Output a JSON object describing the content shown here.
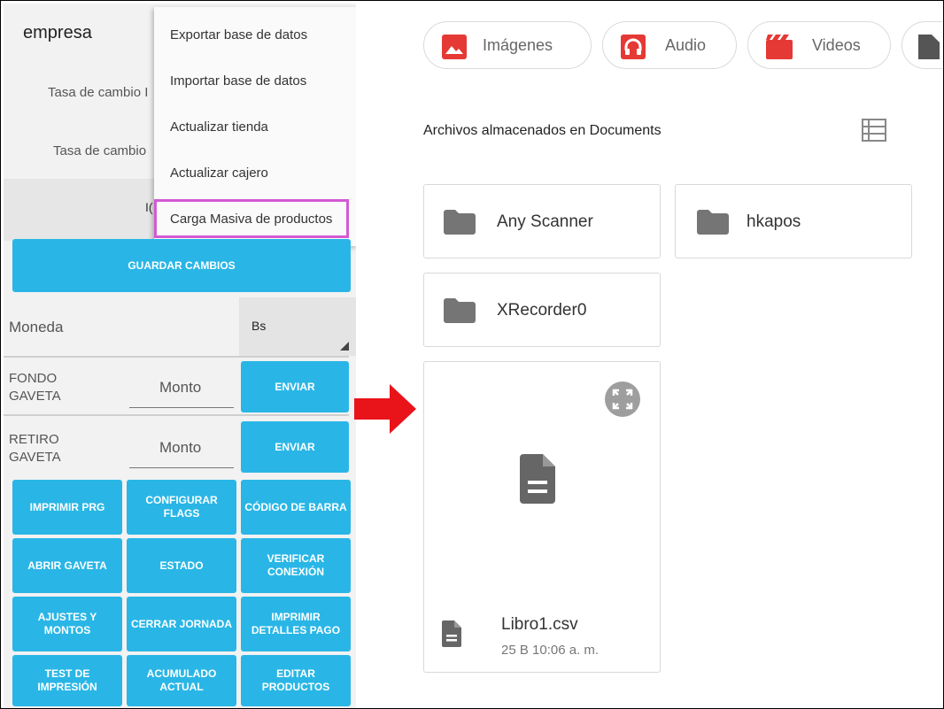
{
  "app": {
    "title": "empresa"
  },
  "rates": [
    {
      "label": "Tasa de cambio I"
    },
    {
      "label": "Tasa de cambio"
    }
  ],
  "hidden_button_fragment": "I(",
  "menu": {
    "items": [
      "Exportar base de datos",
      "Importar base de datos",
      "Actualizar tienda",
      "Actualizar cajero",
      "Carga Masiva de productos"
    ],
    "highlight_color": "#d35ad3"
  },
  "save_label": "GUARDAR CAMBIOS",
  "moneda": {
    "label": "Moneda",
    "value": "Bs"
  },
  "fondo": {
    "label_line1": "FONDO",
    "label_line2": "GAVETA",
    "placeholder": "Monto",
    "button": "ENVIAR"
  },
  "retiro": {
    "label_line1": "RETIRO",
    "label_line2": "GAVETA",
    "placeholder": "Monto",
    "button": "ENVIAR"
  },
  "grid_buttons": [
    {
      "line1": "IMPRIMIR PRG",
      "line2": ""
    },
    {
      "line1": "CONFIGURAR",
      "line2": "FLAGS"
    },
    {
      "line1": "CÓDIGO DE BARRA",
      "line2": ""
    },
    {
      "line1": "ABRIR GAVETA",
      "line2": ""
    },
    {
      "line1": "ESTADO",
      "line2": ""
    },
    {
      "line1": "VERIFICAR",
      "line2": "CONEXIÓN"
    },
    {
      "line1": "AJUSTES Y",
      "line2": "MONTOS"
    },
    {
      "line1": "CERRAR JORNADA",
      "line2": ""
    },
    {
      "line1": "IMPRIMIR",
      "line2": "DETALLES PAGO"
    },
    {
      "line1": "TEST DE",
      "line2": "IMPRESIÓN"
    },
    {
      "line1": "ACUMULADO",
      "line2": "ACTUAL"
    },
    {
      "line1": "EDITAR",
      "line2": "PRODUCTOS"
    }
  ],
  "colors": {
    "accent_blue": "#29b6e6",
    "arrow_red": "#e8141a"
  },
  "file_picker": {
    "chips": [
      {
        "label": "Imágenes",
        "icon": "image-icon"
      },
      {
        "label": "Audio",
        "icon": "headphones-icon"
      },
      {
        "label": "Videos",
        "icon": "video-icon"
      },
      {
        "label": "",
        "icon": "document-icon"
      }
    ],
    "section_title": "Archivos almacenados en Documents",
    "folders": [
      "Any Scanner",
      "hkapos",
      "XRecorder0"
    ],
    "file": {
      "name": "Libro1.csv",
      "meta": "25 B 10:06 a. m."
    }
  }
}
